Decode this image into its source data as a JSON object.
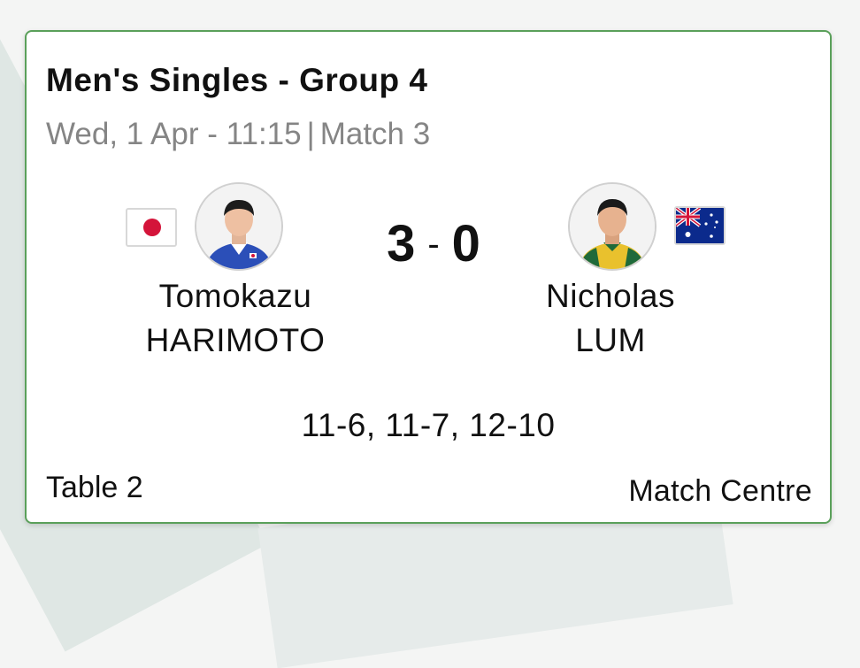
{
  "match": {
    "title": "Men's Singles - Group 4",
    "date_time": "Wed, 1 Apr - 11:15",
    "separator": "|",
    "match_number": "Match 3",
    "player1": {
      "first_name": "Tomokazu",
      "last_name": "HARIMOTO",
      "flag_icon": "japan-flag-icon"
    },
    "player2": {
      "first_name": "Nicholas",
      "last_name": "LUM",
      "flag_icon": "australia-flag-icon"
    },
    "score": {
      "player1": "3",
      "dash": "-",
      "player2": "0"
    },
    "games": "11-6, 11-7, 12-10",
    "table": "Table 2",
    "match_centre_link": "Match Centre"
  },
  "colors": {
    "card_border": "#5aa05a",
    "subtitle": "#858585",
    "japan_red": "#d4143a",
    "australia_blue": "#0b2a8c"
  }
}
